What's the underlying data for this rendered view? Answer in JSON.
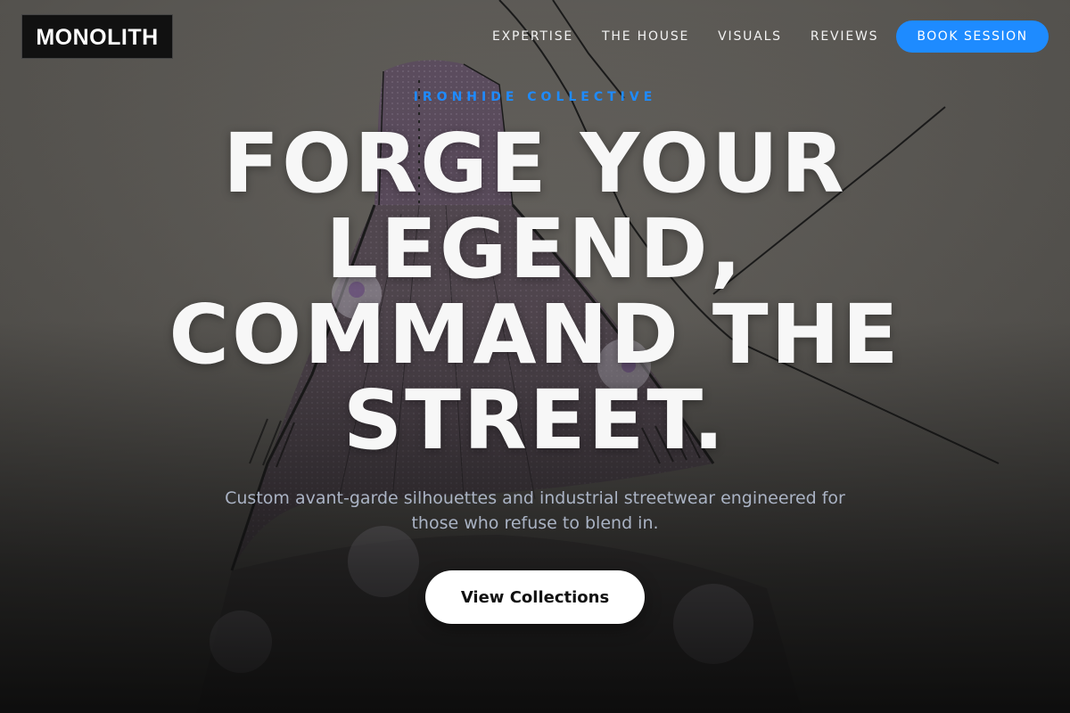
{
  "brand": {
    "logo_text": "MONOLITH"
  },
  "nav": {
    "links": [
      "EXPERTISE",
      "THE HOUSE",
      "VISUALS",
      "REVIEWS"
    ],
    "cta_label": "BOOK SESSION"
  },
  "hero": {
    "eyebrow": "IRONHIDE COLLECTIVE",
    "headline": "FORGE YOUR LEGEND, COMMAND THE STREET.",
    "subtext": "Custom avant-garde silhouettes and industrial streetwear engineered for those who refuse to blend in.",
    "cta_label": "View Collections",
    "background_image": "fashion-sketch-gown"
  },
  "colors": {
    "accent": "#1e8bff",
    "background": "#5b5955",
    "headline": "#f7f7f7",
    "subtext": "#aab3c4"
  }
}
